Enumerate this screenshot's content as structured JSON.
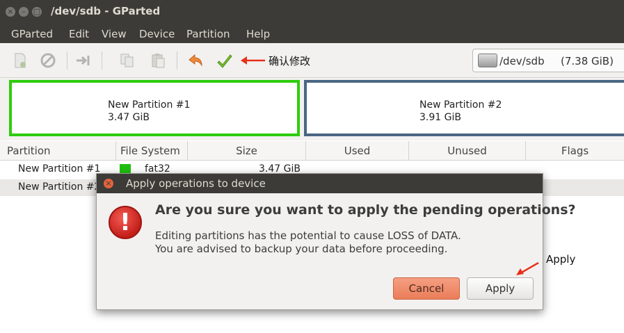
{
  "window": {
    "title": "/dev/sdb - GParted",
    "controls": {
      "close": "×",
      "minimize": "–",
      "maximize": "□"
    }
  },
  "menu": [
    "GParted",
    "Edit",
    "View",
    "Device",
    "Partition",
    "Help"
  ],
  "toolbar": {
    "icons": [
      "new-icon",
      "delete-icon",
      "resize-icon",
      "copy-icon",
      "paste-icon",
      "undo-icon",
      "apply-checkmark-icon"
    ],
    "annotation_confirm": "确认修改",
    "device": {
      "name": "/dev/sdb",
      "size": "(7.38 GiB)"
    }
  },
  "partition_map": [
    {
      "name": "New Partition #1",
      "size": "3.47 GiB",
      "color": "#2ecc0d"
    },
    {
      "name": "New Partition #2",
      "size": "3.91 GiB",
      "color": "#4a6683"
    }
  ],
  "table": {
    "headers": [
      "Partition",
      "File System",
      "Size",
      "Used",
      "Unused",
      "Flags"
    ],
    "rows": [
      {
        "partition": "New Partition #1",
        "filesystem": "fat32",
        "size": "3.47 GiB",
        "fs_color": "#1fbf0e"
      },
      {
        "partition": "New Partition #2",
        "filesystem": "",
        "size": ""
      }
    ]
  },
  "dialog": {
    "title": "Apply operations to device",
    "heading": "Are you sure you want to apply the pending operations?",
    "line1": "Editing partitions has the potential to cause LOSS of DATA.",
    "line2": "You are advised to backup your data before proceeding.",
    "cancel_label": "Cancel",
    "apply_label": "Apply",
    "icon": "!"
  },
  "annotation_apply": "Apply",
  "colors": {
    "titlebar": "#3c3b37",
    "accent_orange": "#ea7d59",
    "annotation_arrow": "#e8301a"
  }
}
